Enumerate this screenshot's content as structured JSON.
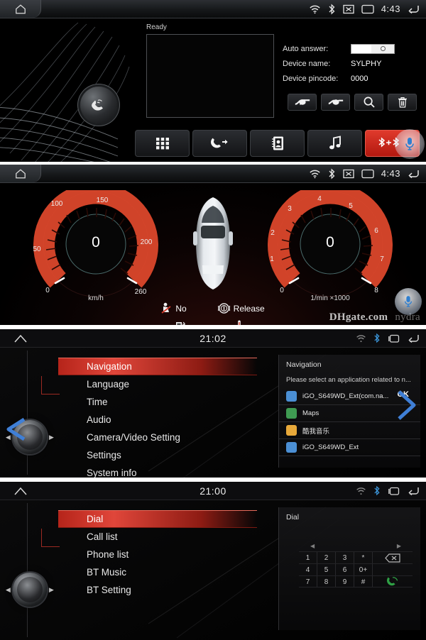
{
  "panels": {
    "bluetooth": {
      "status": {
        "time": "4:43",
        "icons": [
          "wifi-icon",
          "bluetooth-icon",
          "mute-icon",
          "screen-icon"
        ],
        "home": "home-icon",
        "back": "back-icon"
      },
      "ready_label": "Ready",
      "auto_answer_label": "Auto answer:",
      "device_name_label": "Device name:",
      "device_name_value": "SYLPHY",
      "pincode_label": "Device pincode:",
      "pincode_value": "0000",
      "action_icons": [
        "connect-icon",
        "disconnect-icon",
        "search-icon",
        "delete-icon"
      ],
      "tabs": [
        {
          "name": "keypad",
          "icon": "keypad-icon",
          "active": false
        },
        {
          "name": "call-log",
          "icon": "call-log-icon",
          "active": false
        },
        {
          "name": "contacts",
          "icon": "contacts-icon",
          "active": false
        },
        {
          "name": "music",
          "icon": "music-note-icon",
          "active": false
        },
        {
          "name": "bluetooth-pair",
          "icon": "bluetooth-pair-icon",
          "active": true
        }
      ]
    },
    "cluster": {
      "status": {
        "time": "4:43"
      },
      "speed": {
        "value": "0",
        "unit": "km/h",
        "ticks": [
          "0",
          "50",
          "100",
          "150",
          "200",
          "260"
        ]
      },
      "rpm": {
        "value": "0",
        "unit": "1/min ×1000",
        "ticks": [
          "0",
          "1",
          "2",
          "3",
          "4",
          "5",
          "6",
          "7",
          "8"
        ]
      },
      "indicators": [
        {
          "icon": "seatbelt-icon",
          "text": "No"
        },
        {
          "icon": "brake-icon",
          "text": "Release"
        }
      ],
      "meters": [
        {
          "icon": "fuel-icon",
          "text": "--"
        },
        {
          "icon": "temperature-icon",
          "text": "--"
        }
      ],
      "watermark_main": "DHgate.com",
      "watermark_sub": "nydra"
    },
    "settings": {
      "status": {
        "time": "21:02"
      },
      "menu": [
        {
          "label": "Navigation",
          "selected": true
        },
        {
          "label": "Language",
          "selected": false
        },
        {
          "label": "Time",
          "selected": false
        },
        {
          "label": "Audio",
          "selected": false
        },
        {
          "label": "Camera/Video Setting",
          "selected": false
        },
        {
          "label": "Settings",
          "selected": false
        },
        {
          "label": "System info",
          "selected": false
        }
      ],
      "detail": {
        "title": "Navigation",
        "prompt": "Please select an application related to n...",
        "ok_label": "OK",
        "apps": [
          {
            "label": "iGO_S649WD_Ext(com.na...",
            "color": "#4b8fd4"
          },
          {
            "label": "Maps",
            "color": "#3f9b52"
          },
          {
            "label": "酷我音乐",
            "color": "#e8a93a"
          },
          {
            "label": "iGO_S649WD_Ext",
            "color": "#4b8fd4"
          }
        ]
      }
    },
    "phone": {
      "status": {
        "time": "21:00"
      },
      "menu": [
        {
          "label": "Dial",
          "selected": true
        },
        {
          "label": "Call list",
          "selected": false
        },
        {
          "label": "Phone list",
          "selected": false
        },
        {
          "label": "BT Music",
          "selected": false
        },
        {
          "label": "BT Setting",
          "selected": false
        }
      ],
      "detail": {
        "title": "Dial",
        "keys": [
          [
            "1",
            "2",
            "3",
            "*"
          ],
          [
            "4",
            "5",
            "6",
            "0+"
          ],
          [
            "7",
            "8",
            "9",
            "#"
          ]
        ],
        "side_actions": [
          "backspace-icon",
          "spacer",
          "call-icon"
        ]
      }
    }
  },
  "colors": {
    "accent_red": "#e0463a",
    "bluetooth_blue": "#2f9fe0",
    "call_green": "#2fa045",
    "gauge_red": "#e2492c"
  }
}
